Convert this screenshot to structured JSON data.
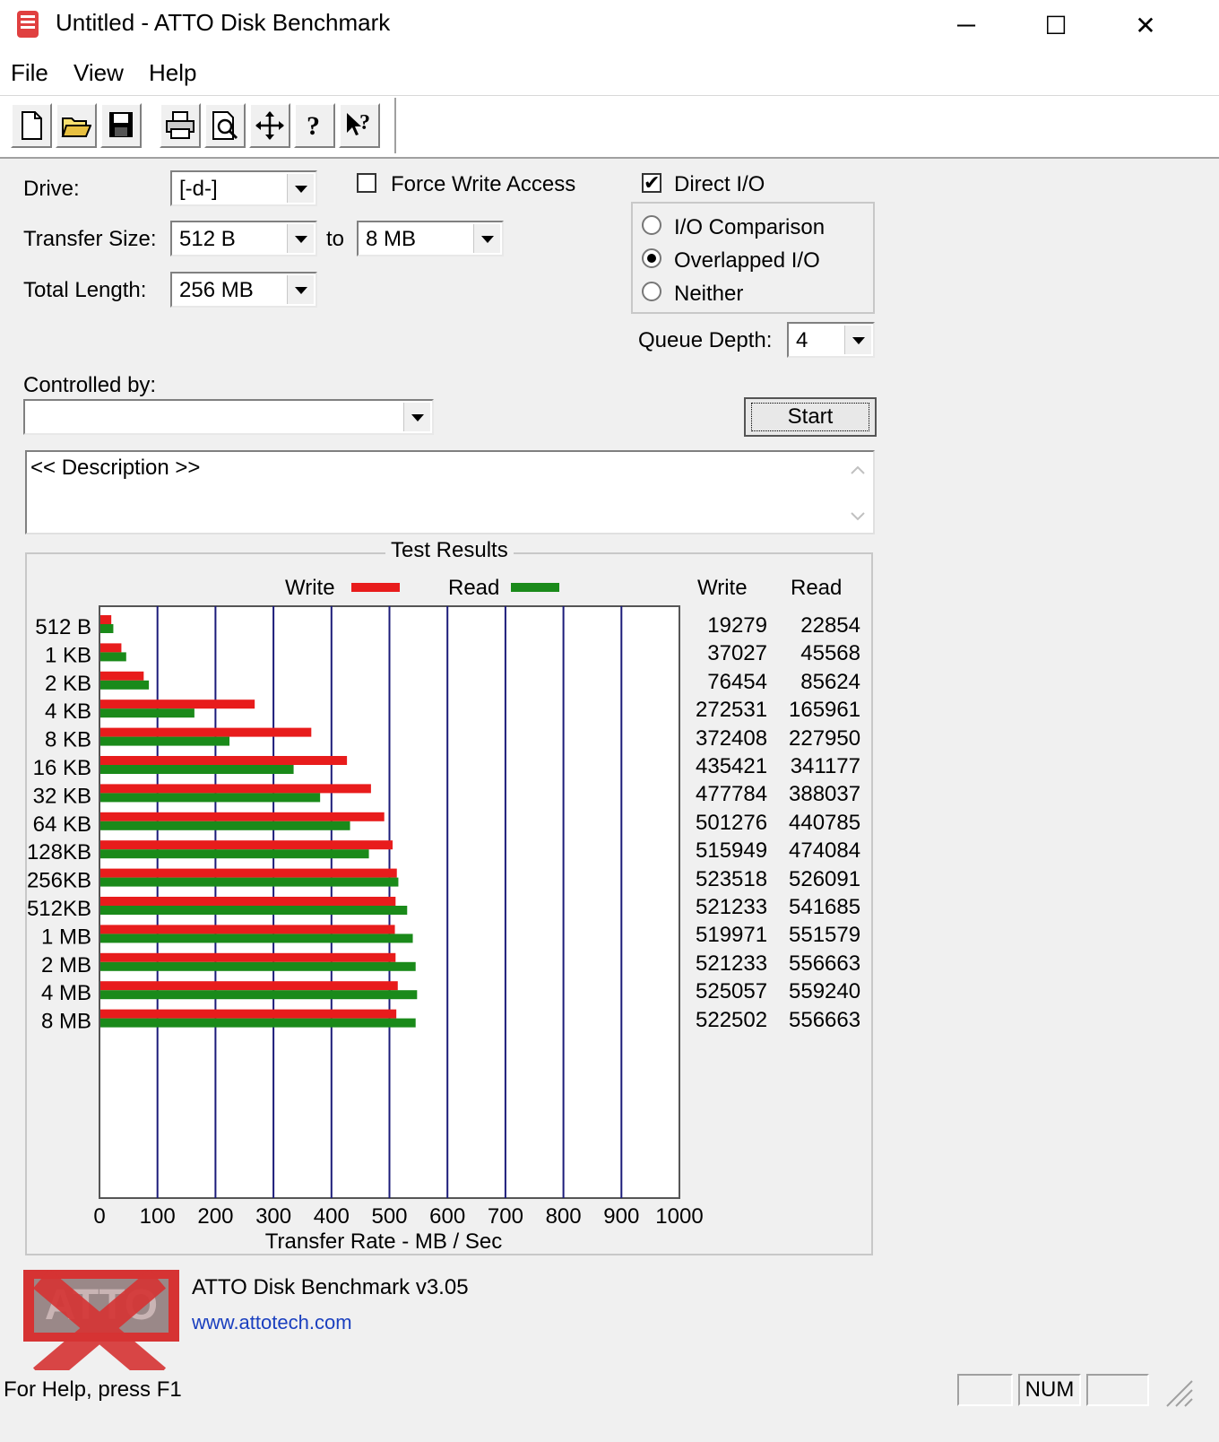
{
  "window": {
    "title": "Untitled - ATTO Disk Benchmark",
    "minimize": "─",
    "maximize": "☐",
    "close": "✕"
  },
  "menu": [
    "File",
    "View",
    "Help"
  ],
  "toolbar": [
    "new-icon",
    "open-icon",
    "save-icon",
    "print-icon",
    "print-preview-icon",
    "move-icon",
    "about-icon",
    "context-help-icon"
  ],
  "form": {
    "drive_label": "Drive:",
    "drive_value": "[-d-]",
    "force_write_label": "Force Write Access",
    "force_write_checked": false,
    "direct_io_label": "Direct I/O",
    "direct_io_checked": true,
    "transfer_size_label": "Transfer Size:",
    "transfer_from": "512 B",
    "to_label": "to",
    "transfer_to": "8 MB",
    "total_length_label": "Total Length:",
    "total_length_value": "256 MB",
    "io_options": [
      "I/O Comparison",
      "Overlapped I/O",
      "Neither"
    ],
    "io_selected": "Overlapped I/O",
    "queue_depth_label": "Queue Depth:",
    "queue_depth_value": "4",
    "controlled_by_label": "Controlled by:",
    "controlled_by_value": "",
    "start_label": "Start",
    "description": "<< Description >>"
  },
  "results": {
    "group_title": "Test Results",
    "legend_write": "Write",
    "legend_read": "Read",
    "col_write": "Write",
    "col_read": "Read",
    "rows": [
      {
        "size": "512 B",
        "write": "19279",
        "read": "22854"
      },
      {
        "size": "1 KB",
        "write": "37027",
        "read": "45568"
      },
      {
        "size": "2 KB",
        "write": "76454",
        "read": "85624"
      },
      {
        "size": "4 KB",
        "write": "272531",
        "read": "165961"
      },
      {
        "size": "8 KB",
        "write": "372408",
        "read": "227950"
      },
      {
        "size": "16 KB",
        "write": "435421",
        "read": "341177"
      },
      {
        "size": "32 KB",
        "write": "477784",
        "read": "388037"
      },
      {
        "size": "64 KB",
        "write": "501276",
        "read": "440785"
      },
      {
        "size": "128KB",
        "write": "515949",
        "read": "474084"
      },
      {
        "size": "256KB",
        "write": "523518",
        "read": "526091"
      },
      {
        "size": "512KB",
        "write": "521233",
        "read": "541685"
      },
      {
        "size": "1 MB",
        "write": "519971",
        "read": "551579"
      },
      {
        "size": "2 MB",
        "write": "521233",
        "read": "556663"
      },
      {
        "size": "4 MB",
        "write": "525057",
        "read": "559240"
      },
      {
        "size": "8 MB",
        "write": "522502",
        "read": "556663"
      }
    ]
  },
  "chart_data": {
    "type": "bar",
    "categories": [
      "512 B",
      "1 KB",
      "2 KB",
      "4 KB",
      "8 KB",
      "16 KB",
      "32 KB",
      "64 KB",
      "128KB",
      "256KB",
      "512KB",
      "1 MB",
      "2 MB",
      "4 MB",
      "8 MB"
    ],
    "series": [
      {
        "name": "Write",
        "color": "#e81c1c",
        "values": [
          18.8,
          36.2,
          74.7,
          266.1,
          363.7,
          425.2,
          466.6,
          489.5,
          503.9,
          511.2,
          509.0,
          507.8,
          509.0,
          512.8,
          510.3
        ]
      },
      {
        "name": "Read",
        "color": "#1a8a1a",
        "values": [
          22.3,
          44.5,
          83.6,
          162.1,
          222.6,
          333.2,
          378.9,
          430.5,
          463.0,
          513.8,
          529.0,
          538.7,
          543.6,
          546.1,
          543.6
        ]
      }
    ],
    "xlabel": "Transfer Rate - MB / Sec",
    "xlim": [
      0,
      1000
    ],
    "xticks": [
      "0",
      "100",
      "200",
      "300",
      "400",
      "500",
      "600",
      "700",
      "800",
      "900",
      "1000"
    ],
    "orientation": "horizontal",
    "grid": true
  },
  "footer": {
    "app_version": "ATTO Disk Benchmark v3.05",
    "url": "www.attotech.com",
    "logo_text": "ATTO"
  },
  "status": {
    "help": "For Help, press F1",
    "num": "NUM"
  }
}
